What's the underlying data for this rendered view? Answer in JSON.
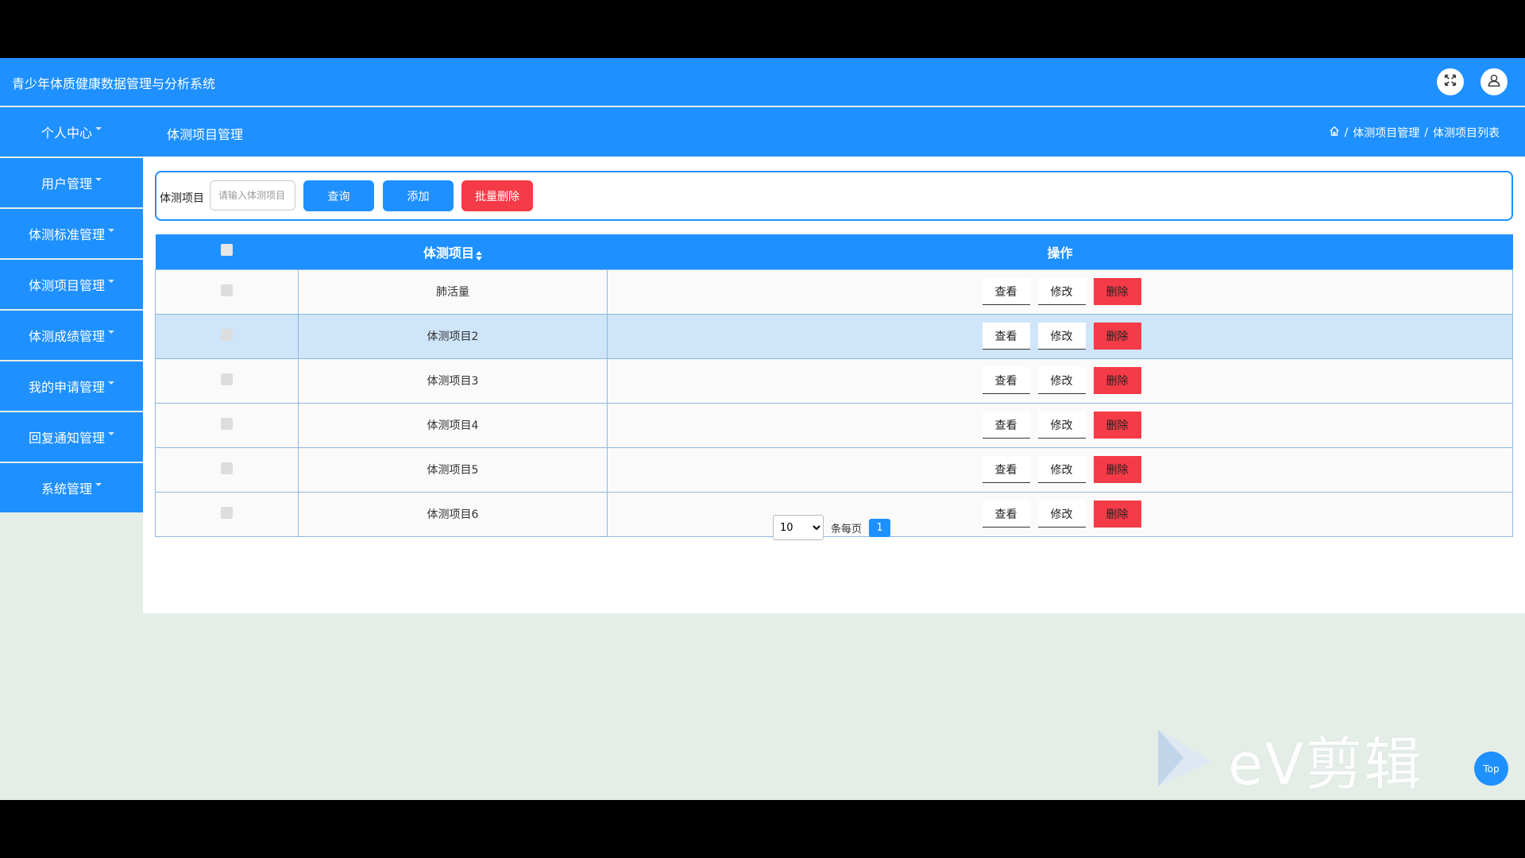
{
  "header": {
    "title": "青少年体质健康数据管理与分析系统",
    "fullscreen_icon": "expand-arrows-icon",
    "user_icon": "user-icon"
  },
  "sidebar": {
    "items": [
      {
        "label": "个人中心"
      },
      {
        "label": "用户管理"
      },
      {
        "label": "体测标准管理"
      },
      {
        "label": "体测项目管理"
      },
      {
        "label": "体测成绩管理"
      },
      {
        "label": "我的申请管理"
      },
      {
        "label": "回复通知管理"
      },
      {
        "label": "系统管理"
      }
    ]
  },
  "topbar": {
    "title": "体测项目管理",
    "breadcrumb": [
      "体测项目管理",
      "体测项目列表"
    ],
    "separator": "/"
  },
  "search": {
    "label": "体测项目",
    "placeholder": "请输入体测项目",
    "query_label": "查询",
    "add_label": "添加",
    "batch_delete_label": "批量删除"
  },
  "table": {
    "columns": [
      "体测项目",
      "操作"
    ],
    "rows": [
      {
        "name": "肺活量"
      },
      {
        "name": "体测项目2"
      },
      {
        "name": "体测项目3"
      },
      {
        "name": "体测项目4"
      },
      {
        "name": "体测项目5"
      },
      {
        "name": "体测项目6"
      }
    ],
    "hover_row": 1,
    "actions": {
      "view": "查看",
      "edit": "修改",
      "delete": "删除"
    }
  },
  "pagination": {
    "page_size": "10",
    "page_size_options": [
      "10"
    ],
    "per_page_label": "条每页",
    "current_page": "1"
  },
  "watermark": {
    "text": "eV剪辑"
  },
  "back_to_top": {
    "label": "Top"
  },
  "colors": {
    "primary": "#1e90ff",
    "danger": "#f53b47",
    "background": "#e4ede6",
    "hover_row": "#cfe5fa"
  }
}
